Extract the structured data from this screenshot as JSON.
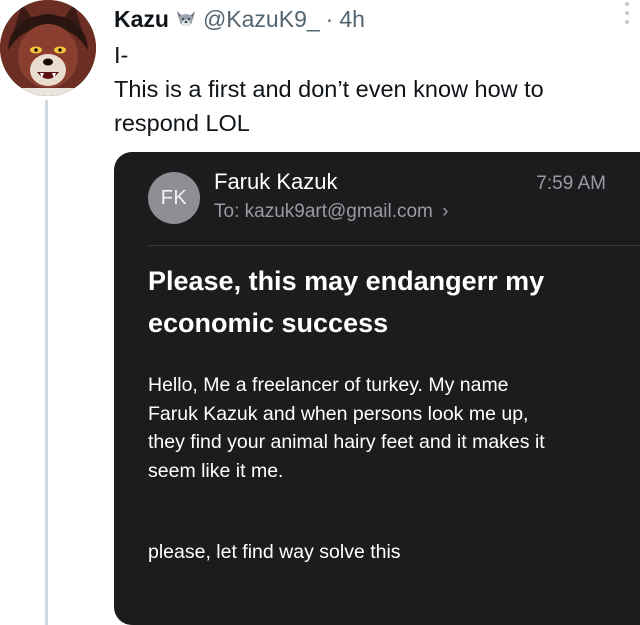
{
  "tweet": {
    "display_name": "Kazu",
    "name_emoji": "🐺",
    "handle": "@KazuK9_",
    "separator": "·",
    "time": "4h",
    "text_lines": [
      "I-",
      "This is a first and don’t even know how to",
      "respond LOL"
    ]
  },
  "email": {
    "avatar_initials": "FK",
    "sender": "Faruk Kazuk",
    "time": "7:59 AM",
    "to_label": "To:",
    "to_address": "kazuk9art@gmail.com",
    "to_chevron": "›",
    "subject_lines": [
      "Please, this may endangerr my",
      "economic success"
    ],
    "body_lines": [
      "Hello, Me a freelancer of turkey. My name",
      "Faruk Kazuk and when persons look me up,",
      "they find your animal hairy feet and it makes it",
      "seem like it me."
    ],
    "closing": "please, let find way solve this"
  },
  "icons": {
    "avatar": "wolf-avatar-icon",
    "more": "more-options-icon",
    "emoji": "wolf-emoji-icon"
  },
  "colors": {
    "email_background": "#1c1c1e",
    "secondary_text": "#536471",
    "thread_line": "#cfd9de"
  }
}
